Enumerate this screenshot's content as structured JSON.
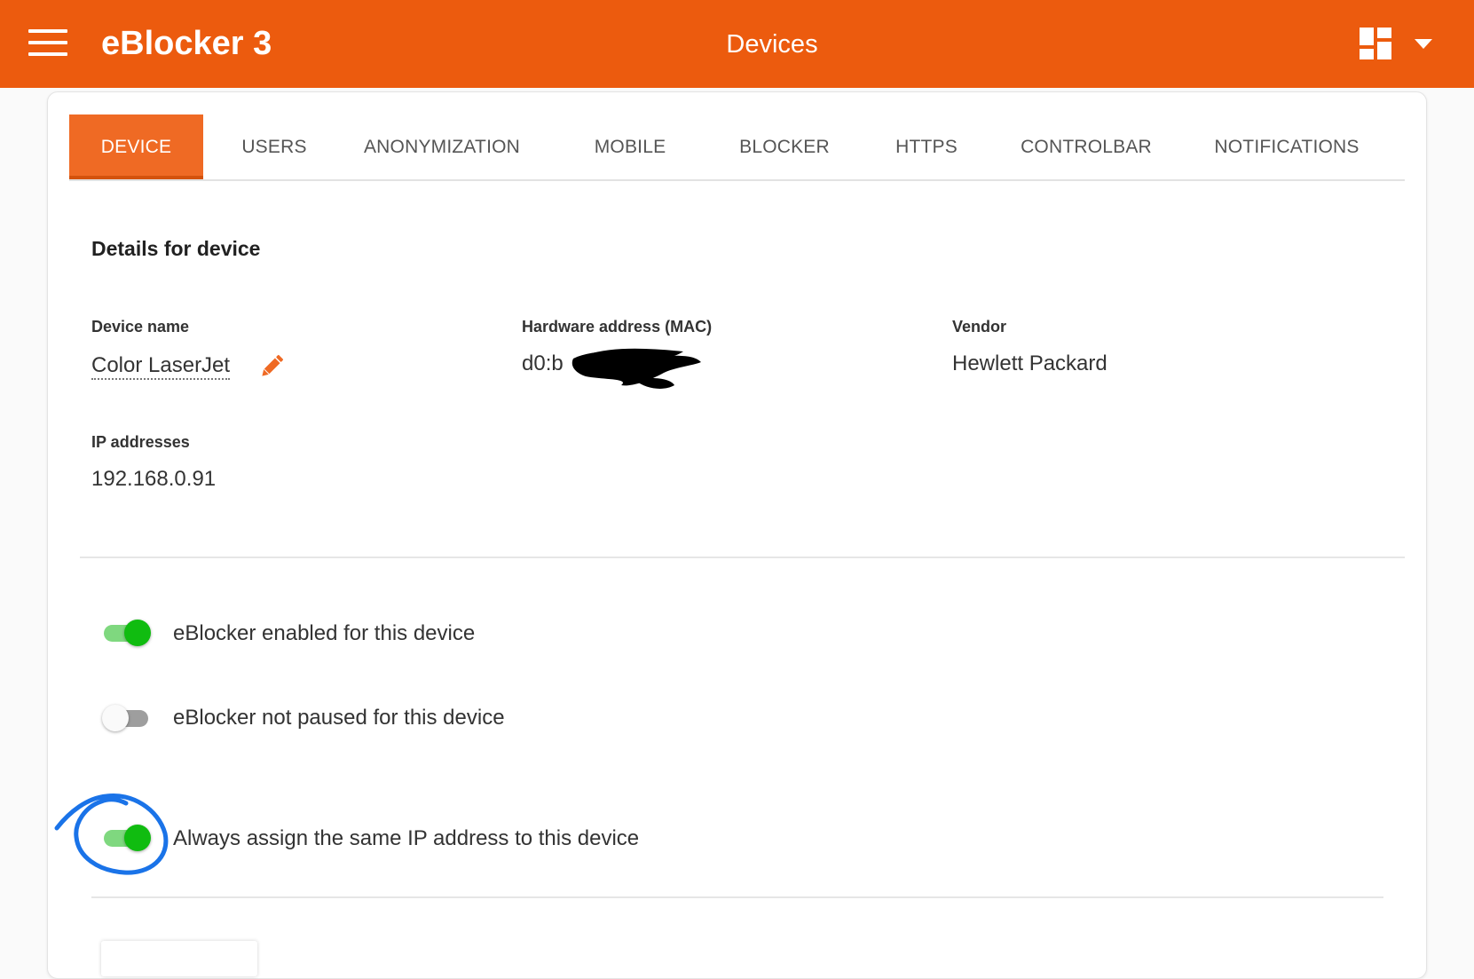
{
  "app": {
    "brand": "eBlocker 3",
    "page_title": "Devices",
    "accent_color": "#ec5b0e",
    "menu_icon": "hamburger-menu-icon",
    "dashboard_icon": "dashboard-grid-icon",
    "dropdown_icon": "caret-down-icon"
  },
  "tabs": [
    {
      "label": "DEVICE",
      "active": true
    },
    {
      "label": "USERS",
      "active": false
    },
    {
      "label": "ANONYMIZATION",
      "active": false
    },
    {
      "label": "MOBILE",
      "active": false
    },
    {
      "label": "BLOCKER",
      "active": false
    },
    {
      "label": "HTTPS",
      "active": false
    },
    {
      "label": "CONTROLBAR",
      "active": false
    },
    {
      "label": "NOTIFICATIONS",
      "active": false
    }
  ],
  "details": {
    "title": "Details for device",
    "device_name_label": "Device name",
    "device_name_value": "Color LaserJet",
    "edit_icon": "pencil-icon",
    "mac_label": "Hardware address (MAC)",
    "mac_value_visible": "d0:b",
    "vendor_label": "Vendor",
    "vendor_value": "Hewlett Packard",
    "ip_label": "IP addresses",
    "ip_value": "192.168.0.91"
  },
  "toggles": [
    {
      "label": "eBlocker enabled for this device",
      "on": true
    },
    {
      "label": "eBlocker not paused for this device",
      "on": false
    },
    {
      "label": "Always assign the same IP address to this device",
      "on": true
    }
  ],
  "colors": {
    "toggle_on": "#10bc10",
    "toggle_on_track": "#7fd87f",
    "toggle_off_track": "#9e9e9e",
    "annotation": "#1a73e8"
  }
}
